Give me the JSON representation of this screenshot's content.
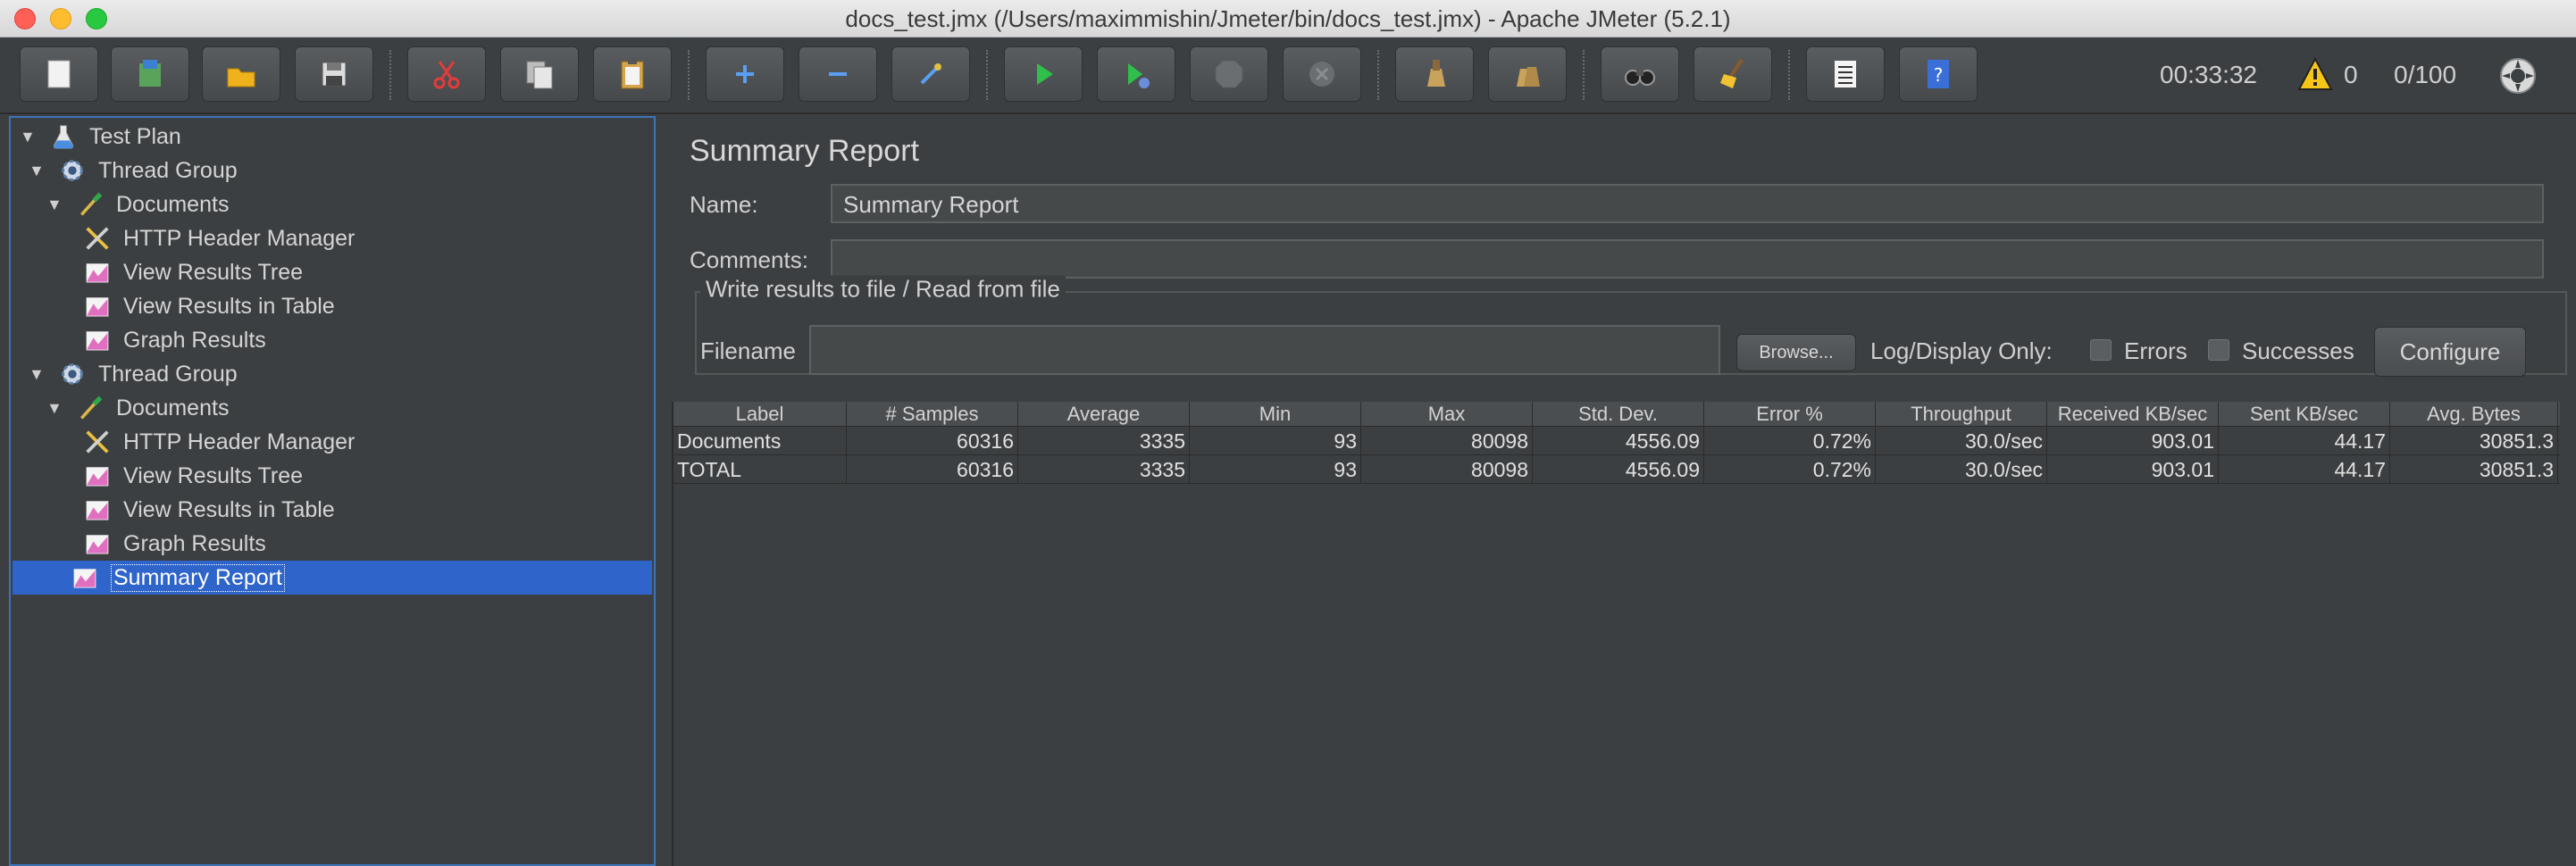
{
  "window": {
    "title": "docs_test.jmx (/Users/maximmishin/Jmeter/bin/docs_test.jmx) - Apache JMeter (5.2.1)"
  },
  "toolbar": {
    "elapsed_time": "00:33:32",
    "warning_count": "0",
    "threads": "0/100",
    "buttons": [
      "new-icon",
      "templates-icon",
      "open-icon",
      "save-icon",
      "cut-icon",
      "copy-icon",
      "paste-icon",
      "expand-icon",
      "collapse-icon",
      "toggle-icon",
      "start-icon",
      "start-no-pause-icon",
      "stop-icon",
      "shutdown-icon",
      "clear-icon",
      "clear-all-icon",
      "search-icon",
      "reset-search-icon",
      "function-helper-icon",
      "help-icon"
    ]
  },
  "tree": {
    "items": [
      {
        "label": "Test Plan",
        "level": 0,
        "icon": "flask-icon",
        "expanded": true
      },
      {
        "label": "Thread Group",
        "level": 1,
        "icon": "gear-icon",
        "expanded": true
      },
      {
        "label": "Documents",
        "level": 2,
        "icon": "dropper-icon",
        "expanded": true
      },
      {
        "label": "HTTP Header Manager",
        "level": 3,
        "icon": "wrench-icon"
      },
      {
        "label": "View Results Tree",
        "level": 3,
        "icon": "graph-icon"
      },
      {
        "label": "View Results in Table",
        "level": 3,
        "icon": "graph-icon"
      },
      {
        "label": "Graph Results",
        "level": 3,
        "icon": "graph-icon"
      },
      {
        "label": "Thread Group",
        "level": 1,
        "icon": "gear-icon",
        "expanded": true
      },
      {
        "label": "Documents",
        "level": 2,
        "icon": "dropper-icon",
        "expanded": true
      },
      {
        "label": "HTTP Header Manager",
        "level": 3,
        "icon": "wrench-icon"
      },
      {
        "label": "View Results Tree",
        "level": 3,
        "icon": "graph-icon"
      },
      {
        "label": "View Results in Table",
        "level": 3,
        "icon": "graph-icon"
      },
      {
        "label": "Graph Results",
        "level": 3,
        "icon": "graph-icon"
      },
      {
        "label": "Summary Report",
        "level": 2,
        "icon": "graph-icon",
        "selected": true
      }
    ]
  },
  "panel": {
    "title": "Summary Report",
    "name_label": "Name:",
    "name_value": "Summary Report",
    "comments_label": "Comments:",
    "comments_value": "",
    "file_legend": "Write results to file / Read from file",
    "filename_label": "Filename",
    "filename_value": "",
    "browse_label": "Browse...",
    "log_display_label": "Log/Display Only:",
    "errors_label": "Errors",
    "successes_label": "Successes",
    "configure_label": "Configure"
  },
  "table": {
    "headers": [
      "Label",
      "# Samples",
      "Average",
      "Min",
      "Max",
      "Std. Dev.",
      "Error %",
      "Throughput",
      "Received KB/sec",
      "Sent KB/sec",
      "Avg. Bytes"
    ],
    "rows": [
      [
        "Documents",
        "60316",
        "3335",
        "93",
        "80098",
        "4556.09",
        "0.72%",
        "30.0/sec",
        "903.01",
        "44.17",
        "30851.3"
      ],
      [
        "TOTAL",
        "60316",
        "3335",
        "93",
        "80098",
        "4556.09",
        "0.72%",
        "30.0/sec",
        "903.01",
        "44.17",
        "30851.3"
      ]
    ]
  },
  "colors": {
    "background": "#3c3f41",
    "selection": "#2f65ca",
    "focus_border": "#3d74b8"
  }
}
